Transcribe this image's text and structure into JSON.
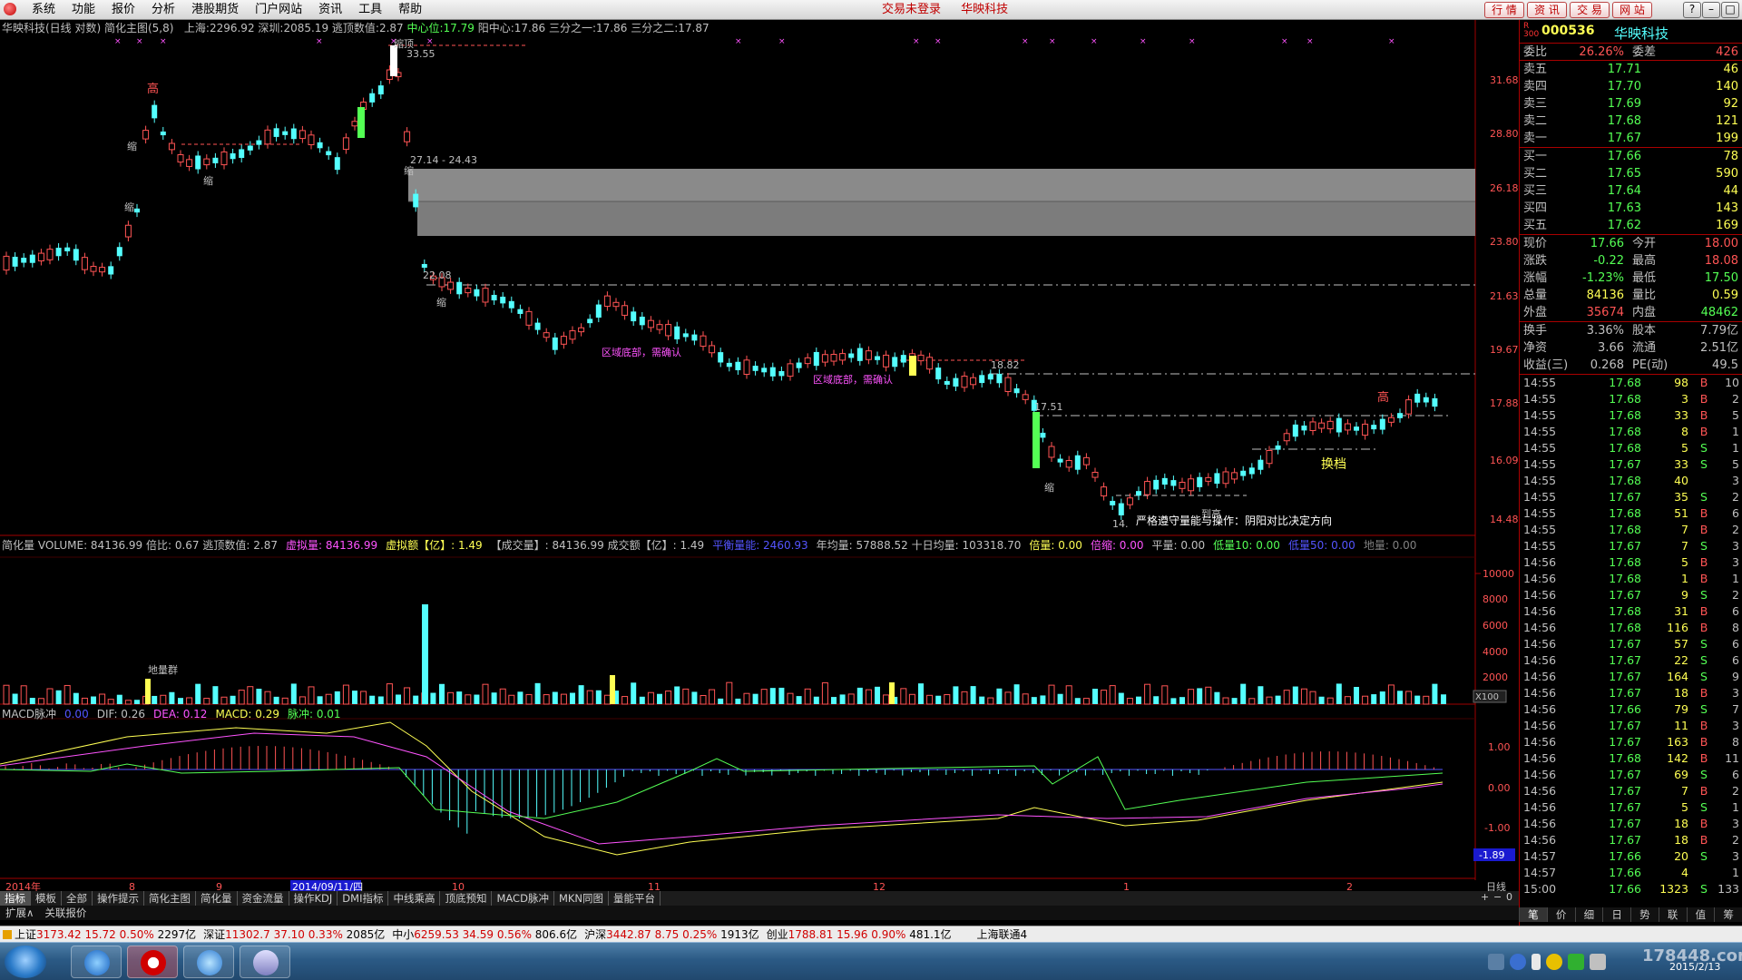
{
  "menubar": {
    "items": [
      "系统",
      "功能",
      "报价",
      "分析",
      "港股期货",
      "门户网站",
      "资讯",
      "工具",
      "帮助"
    ],
    "status": "交易未登录",
    "stock_name": "华映科技",
    "right_buttons": [
      "行 情",
      "资 讯",
      "交 易",
      "网 站"
    ],
    "window_buttons": [
      "?",
      "–",
      "□",
      "✕"
    ]
  },
  "main_chart": {
    "title": "华映科技(日线 对数) 简化主图(5,8)",
    "shanghai_label": "上海:",
    "shanghai": "2296.92",
    "shenzhen_label": "深圳:",
    "shenzhen": "2085.19",
    "escape_label": "逃顶数值:",
    "escape": "2.87",
    "center_label": "中心位:",
    "center": "17.79",
    "yang_label": "阳中心:",
    "yang": "17.86",
    "third1_label": "三分之一:",
    "third1": "17.86",
    "third2_label": "三分之二:",
    "third2": "17.87",
    "price_ticks": [
      "31.68",
      "28.80",
      "26.18",
      "23.80",
      "21.63",
      "19.67",
      "17.88",
      "16.09",
      "14.48"
    ],
    "annotations": {
      "peak": "33.55",
      "gap_range": "27.14 - 24.43",
      "low1": "22.08",
      "level1": "18.82",
      "level2": "17.51",
      "low2": "14.",
      "high1": "高",
      "high2": "高",
      "shrink": "缩",
      "shrink_top": "缩顶",
      "bottom_note1": "区域底部，需确认",
      "bottom_note2": "区域底部，需确认",
      "change_gear": "换档",
      "sell_note": "到高",
      "strategy": "严格遵守量能与操作：阴阳对比决定方向"
    }
  },
  "volume_panel": {
    "header": [
      {
        "t": "简化量 VOLUME: 84136.99 倍比: 0.67 逃顶数值: 2.87",
        "c": "#c0c0c0"
      },
      {
        "t": "虚拟量: 84136.99",
        "c": "#ff54ff"
      },
      {
        "t": "虚拟额【亿】: 1.49",
        "c": "#ffff54"
      },
      {
        "t": "【成交量】: 84136.99 成交额【亿】: 1.49",
        "c": "#c0c0c0"
      },
      {
        "t": "平衡量能: 2460.93",
        "c": "#5454ff"
      },
      {
        "t": "年均量: 57888.52 十日均量: 103318.70",
        "c": "#c0c0c0"
      },
      {
        "t": "倍量: 0.00",
        "c": "#ffff54"
      },
      {
        "t": "倍缩: 0.00",
        "c": "#ff54ff"
      },
      {
        "t": "平量: 0.00",
        "c": "#c0c0c0"
      },
      {
        "t": "低量10: 0.00",
        "c": "#54ff54"
      },
      {
        "t": "低量50: 0.00",
        "c": "#5454ff"
      },
      {
        "t": "地量: 0.00",
        "c": "#808080"
      }
    ],
    "ticks": [
      "10000",
      "8000",
      "6000",
      "4000",
      "2000"
    ],
    "unit": "X100",
    "label": "地量群"
  },
  "macd_panel": {
    "header": [
      {
        "t": "MACD脉冲",
        "c": "#c0c0c0"
      },
      {
        "t": "0.00",
        "c": "#5454ff"
      },
      {
        "t": "DIF: 0.26",
        "c": "#c0c0c0"
      },
      {
        "t": "DEA: 0.12",
        "c": "#ff54ff"
      },
      {
        "t": "MACD: 0.29",
        "c": "#ffff54"
      },
      {
        "t": "脉冲: 0.01",
        "c": "#54ff54"
      }
    ],
    "ticks": [
      "1.00",
      "0.00",
      "-1.00"
    ],
    "current": "-1.89"
  },
  "date_axis": {
    "labels": [
      "2014年",
      "8",
      "9",
      "2014/09/11/四",
      "10",
      "11",
      "12",
      "1",
      "2"
    ],
    "period": "日线"
  },
  "tabs": [
    "指标",
    "模板",
    "全部",
    "操作提示",
    "简化主图",
    "简化量",
    "资金流量",
    "操作KDJ",
    "DMI指标",
    "中线乘高",
    "顶底预知",
    "MACD脉冲",
    "MKN同图",
    "量能平台"
  ],
  "tabs2": [
    "扩展∧",
    "关联报价"
  ],
  "scroll": [
    "+",
    "−",
    "0"
  ],
  "right_panel": {
    "badge": [
      "R",
      "300"
    ],
    "code": "000536",
    "name": "华映科技",
    "wb_label": "委比",
    "wb": "26.26%",
    "wc_label": "委差",
    "wc": "426",
    "asks": [
      {
        "label": "卖五",
        "price": "17.71",
        "vol": "46"
      },
      {
        "label": "卖四",
        "price": "17.70",
        "vol": "140"
      },
      {
        "label": "卖三",
        "price": "17.69",
        "vol": "92"
      },
      {
        "label": "卖二",
        "price": "17.68",
        "vol": "121"
      },
      {
        "label": "卖一",
        "price": "17.67",
        "vol": "199"
      }
    ],
    "bids": [
      {
        "label": "买一",
        "price": "17.66",
        "vol": "78"
      },
      {
        "label": "买二",
        "price": "17.65",
        "vol": "590"
      },
      {
        "label": "买三",
        "price": "17.64",
        "vol": "44"
      },
      {
        "label": "买四",
        "price": "17.63",
        "vol": "143"
      },
      {
        "label": "买五",
        "price": "17.62",
        "vol": "169"
      }
    ],
    "quote": [
      {
        "l1": "现价",
        "v1": "17.66",
        "c1": "dn",
        "l2": "今开",
        "v2": "18.00",
        "c2": "up"
      },
      {
        "l1": "涨跌",
        "v1": "-0.22",
        "c1": "dn",
        "l2": "最高",
        "v2": "18.08",
        "c2": "up"
      },
      {
        "l1": "涨幅",
        "v1": "-1.23%",
        "c1": "dn",
        "l2": "最低",
        "v2": "17.50",
        "c2": "dn"
      },
      {
        "l1": "总量",
        "v1": "84136",
        "c1": "ye",
        "l2": "量比",
        "v2": "0.59",
        "c2": "ye"
      },
      {
        "l1": "外盘",
        "v1": "35674",
        "c1": "up",
        "l2": "内盘",
        "v2": "48462",
        "c2": "dn"
      }
    ],
    "stats": [
      {
        "l1": "换手",
        "v1": "3.36%",
        "l2": "股本",
        "v2": "7.79亿"
      },
      {
        "l1": "净资",
        "v1": "3.66",
        "l2": "流通",
        "v2": "2.51亿"
      },
      {
        "l1": "收益(三)",
        "v1": "0.268",
        "l2": "PE(动)",
        "v2": "49.5"
      }
    ],
    "ticks": [
      {
        "t": "14:55",
        "p": "17.68",
        "v": "98",
        "d": "B",
        "n": "10"
      },
      {
        "t": "14:55",
        "p": "17.68",
        "v": "3",
        "d": "B",
        "n": "2"
      },
      {
        "t": "14:55",
        "p": "17.68",
        "v": "33",
        "d": "B",
        "n": "5"
      },
      {
        "t": "14:55",
        "p": "17.68",
        "v": "8",
        "d": "B",
        "n": "1"
      },
      {
        "t": "14:55",
        "p": "17.68",
        "v": "5",
        "d": "S",
        "n": "1"
      },
      {
        "t": "14:55",
        "p": "17.67",
        "v": "33",
        "d": "S",
        "n": "5"
      },
      {
        "t": "14:55",
        "p": "17.68",
        "v": "40",
        "d": "",
        "n": "3"
      },
      {
        "t": "14:55",
        "p": "17.67",
        "v": "35",
        "d": "S",
        "n": "2"
      },
      {
        "t": "14:55",
        "p": "17.68",
        "v": "51",
        "d": "B",
        "n": "6"
      },
      {
        "t": "14:55",
        "p": "17.68",
        "v": "7",
        "d": "B",
        "n": "2"
      },
      {
        "t": "14:55",
        "p": "17.67",
        "v": "7",
        "d": "S",
        "n": "3"
      },
      {
        "t": "14:56",
        "p": "17.68",
        "v": "5",
        "d": "B",
        "n": "3"
      },
      {
        "t": "14:56",
        "p": "17.68",
        "v": "1",
        "d": "B",
        "n": "1"
      },
      {
        "t": "14:56",
        "p": "17.67",
        "v": "9",
        "d": "S",
        "n": "2"
      },
      {
        "t": "14:56",
        "p": "17.68",
        "v": "31",
        "d": "B",
        "n": "6"
      },
      {
        "t": "14:56",
        "p": "17.68",
        "v": "116",
        "d": "B",
        "n": "8"
      },
      {
        "t": "14:56",
        "p": "17.67",
        "v": "57",
        "d": "S",
        "n": "6"
      },
      {
        "t": "14:56",
        "p": "17.67",
        "v": "22",
        "d": "S",
        "n": "6"
      },
      {
        "t": "14:56",
        "p": "17.67",
        "v": "164",
        "d": "S",
        "n": "9"
      },
      {
        "t": "14:56",
        "p": "17.67",
        "v": "18",
        "d": "B",
        "n": "3"
      },
      {
        "t": "14:56",
        "p": "17.66",
        "v": "79",
        "d": "S",
        "n": "7"
      },
      {
        "t": "14:56",
        "p": "17.67",
        "v": "11",
        "d": "B",
        "n": "3"
      },
      {
        "t": "14:56",
        "p": "17.67",
        "v": "163",
        "d": "B",
        "n": "8"
      },
      {
        "t": "14:56",
        "p": "17.68",
        "v": "142",
        "d": "B",
        "n": "11"
      },
      {
        "t": "14:56",
        "p": "17.67",
        "v": "69",
        "d": "S",
        "n": "6"
      },
      {
        "t": "14:56",
        "p": "17.67",
        "v": "7",
        "d": "B",
        "n": "2"
      },
      {
        "t": "14:56",
        "p": "17.67",
        "v": "5",
        "d": "S",
        "n": "1"
      },
      {
        "t": "14:56",
        "p": "17.67",
        "v": "18",
        "d": "B",
        "n": "3"
      },
      {
        "t": "14:56",
        "p": "17.67",
        "v": "18",
        "d": "B",
        "n": "2"
      },
      {
        "t": "14:57",
        "p": "17.66",
        "v": "20",
        "d": "S",
        "n": "3"
      },
      {
        "t": "14:57",
        "p": "17.66",
        "v": "4",
        "d": "",
        "n": "1"
      },
      {
        "t": "15:00",
        "p": "17.66",
        "v": "1323",
        "d": "S",
        "n": "133"
      }
    ],
    "tabs": [
      "笔",
      "价",
      "细",
      "日",
      "势",
      "联",
      "值",
      "筹"
    ]
  },
  "index_bar": [
    {
      "name": "上证",
      "value": "3173.42",
      "chg": "15.72",
      "pct": "0.50%",
      "amt": "2297亿"
    },
    {
      "name": "深证",
      "value": "11302.7",
      "chg": "37.10",
      "pct": "0.33%",
      "amt": "2085亿"
    },
    {
      "name": "中小",
      "value": "6259.53",
      "chg": "34.59",
      "pct": "0.56%",
      "amt": "806.6亿"
    },
    {
      "name": "沪深",
      "value": "3442.87",
      "chg": "8.75",
      "pct": "0.25%",
      "amt": "1913亿"
    },
    {
      "name": "创业",
      "value": "1788.81",
      "chg": "15.96",
      "pct": "0.90%",
      "amt": "481.1亿"
    }
  ],
  "connection": "上海联通4",
  "taskbar": {
    "date": "2015/2/13",
    "watermark": "178448.com"
  },
  "colors": {
    "up": "#ff5454",
    "down": "#54ffff",
    "grid": "#a00000",
    "bg": "#000000"
  }
}
